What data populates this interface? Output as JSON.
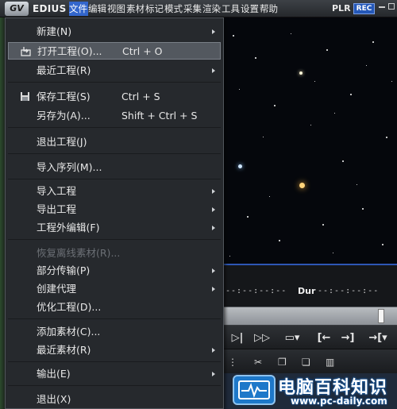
{
  "app": {
    "name": "EDIUS",
    "logo_text": "GV"
  },
  "menubar": {
    "items": [
      "文件",
      "编辑",
      "视图",
      "素材",
      "标记",
      "模式",
      "采集",
      "渲染",
      "工具",
      "设置",
      "帮助"
    ],
    "active_index": 0
  },
  "status": {
    "plr_label": "PLR",
    "rec_label": "REC"
  },
  "file_menu": {
    "items": [
      {
        "label": "新建(N)",
        "shortcut": "",
        "submenu": true,
        "enabled": true,
        "hover": false,
        "icon": ""
      },
      {
        "label": "打开工程(O)...",
        "shortcut": "Ctrl + O",
        "submenu": false,
        "enabled": true,
        "hover": true,
        "icon": "open-project-icon"
      },
      {
        "label": "最近工程(R)",
        "shortcut": "",
        "submenu": true,
        "enabled": true,
        "hover": false,
        "icon": ""
      },
      {
        "label": "保存工程(S)",
        "shortcut": "Ctrl + S",
        "submenu": false,
        "enabled": true,
        "hover": false,
        "icon": "floppy-disk-icon"
      },
      {
        "label": "另存为(A)...",
        "shortcut": "Shift + Ctrl + S",
        "submenu": false,
        "enabled": true,
        "hover": false,
        "icon": ""
      },
      {
        "label": "退出工程(J)",
        "shortcut": "",
        "submenu": false,
        "enabled": true,
        "hover": false,
        "icon": ""
      },
      {
        "label": "导入序列(M)...",
        "shortcut": "",
        "submenu": false,
        "enabled": true,
        "hover": false,
        "icon": ""
      },
      {
        "label": "导入工程",
        "shortcut": "",
        "submenu": true,
        "enabled": true,
        "hover": false,
        "icon": ""
      },
      {
        "label": "导出工程",
        "shortcut": "",
        "submenu": true,
        "enabled": true,
        "hover": false,
        "icon": ""
      },
      {
        "label": "工程外编辑(F)",
        "shortcut": "",
        "submenu": true,
        "enabled": true,
        "hover": false,
        "icon": ""
      },
      {
        "label": "恢复离线素材(R)...",
        "shortcut": "",
        "submenu": false,
        "enabled": false,
        "hover": false,
        "icon": ""
      },
      {
        "label": "部分传输(P)",
        "shortcut": "",
        "submenu": true,
        "enabled": true,
        "hover": false,
        "icon": ""
      },
      {
        "label": "创建代理",
        "shortcut": "",
        "submenu": true,
        "enabled": true,
        "hover": false,
        "icon": ""
      },
      {
        "label": "优化工程(D)...",
        "shortcut": "",
        "submenu": false,
        "enabled": true,
        "hover": false,
        "icon": ""
      },
      {
        "label": "添加素材(C)...",
        "shortcut": "",
        "submenu": false,
        "enabled": true,
        "hover": false,
        "icon": ""
      },
      {
        "label": "最近素材(R)",
        "shortcut": "",
        "submenu": true,
        "enabled": true,
        "hover": false,
        "icon": ""
      },
      {
        "label": "输出(E)",
        "shortcut": "",
        "submenu": true,
        "enabled": true,
        "hover": false,
        "icon": ""
      },
      {
        "label": "退出(X)",
        "shortcut": "",
        "submenu": false,
        "enabled": true,
        "hover": false,
        "icon": ""
      }
    ]
  },
  "player": {
    "timecode_in": "--:--:--:--",
    "dur_label": "Dur",
    "timecode_dur": "--:--:--:--"
  },
  "transport": {
    "buttons": [
      "▷|",
      "▷▷",
      "▭▾",
      "[←",
      "→]",
      "→[▾"
    ]
  },
  "watermark": {
    "title": "电脑百科知识",
    "url": "www.pc-daily.com"
  },
  "colors": {
    "menu_highlight": "#3366cc",
    "preview_border": "#2e57b5",
    "rec_badge": "#2457b8"
  }
}
